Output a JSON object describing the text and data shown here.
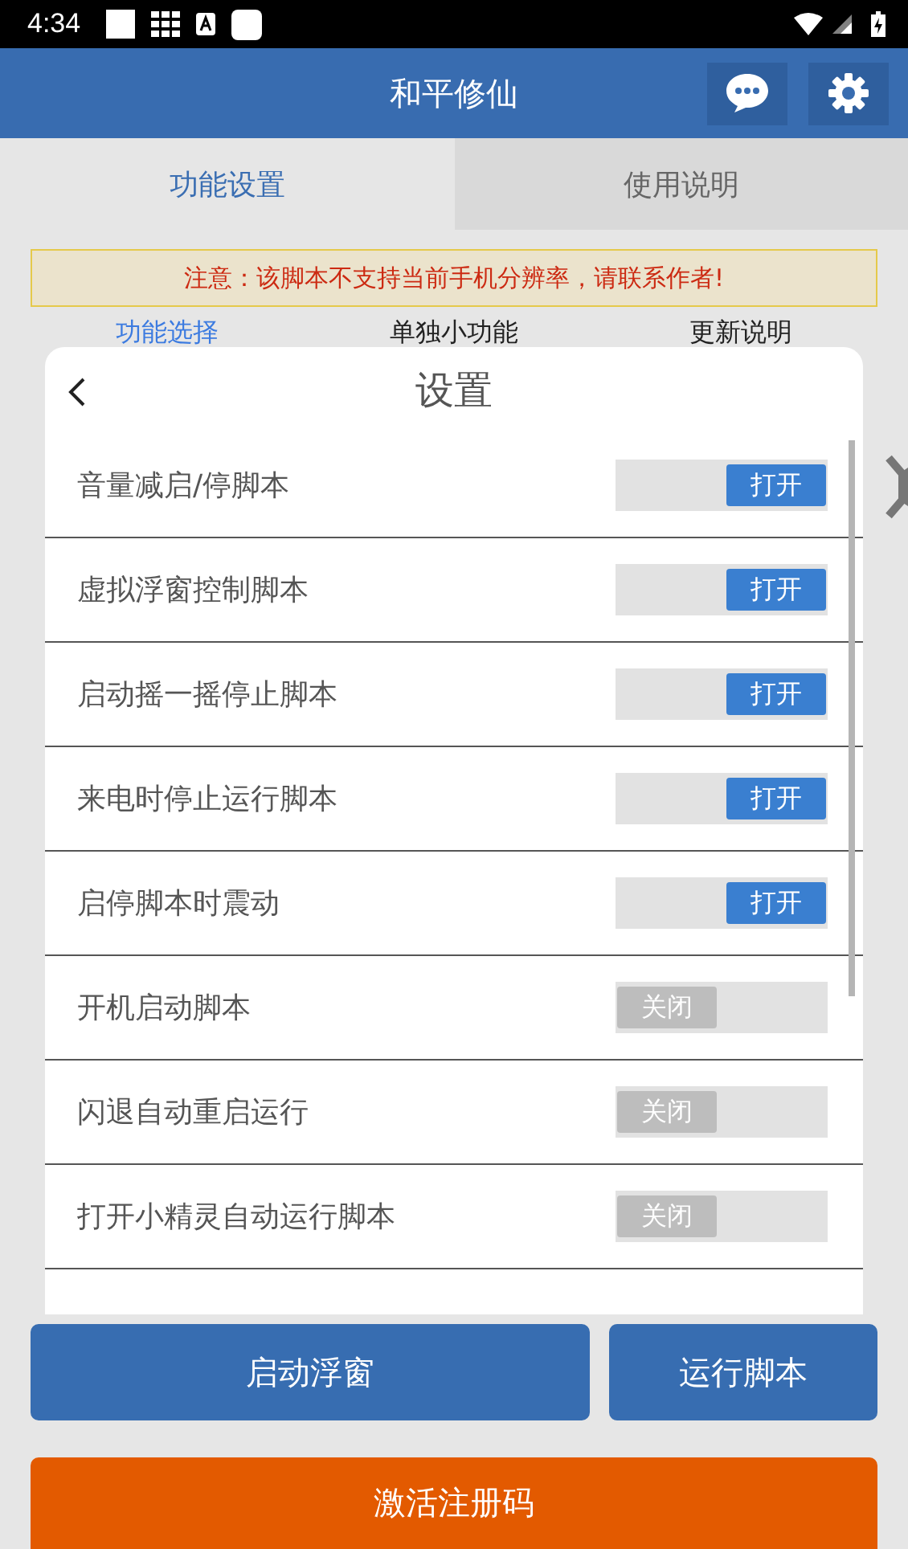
{
  "status_bar": {
    "time": "4:34"
  },
  "app_bar": {
    "title": "和平修仙"
  },
  "tabs": [
    {
      "label": "功能设置",
      "selected": true
    },
    {
      "label": "使用说明",
      "selected": false
    }
  ],
  "notice": "注意：该脚本不支持当前手机分辨率，请联系作者!",
  "sub_tabs": [
    {
      "label": "功能选择",
      "selected": true
    },
    {
      "label": "单独小功能",
      "selected": false
    },
    {
      "label": "更新说明",
      "selected": false
    }
  ],
  "dialog": {
    "title": "设置",
    "items": [
      {
        "label": "音量减启/停脚本",
        "on": true,
        "state_text": "打开"
      },
      {
        "label": "虚拟浮窗控制脚本",
        "on": true,
        "state_text": "打开"
      },
      {
        "label": "启动摇一摇停止脚本",
        "on": true,
        "state_text": "打开"
      },
      {
        "label": "来电时停止运行脚本",
        "on": true,
        "state_text": "打开"
      },
      {
        "label": "启停脚本时震动",
        "on": true,
        "state_text": "打开"
      },
      {
        "label": "开机启动脚本",
        "on": false,
        "state_text": "关闭"
      },
      {
        "label": "闪退自动重启运行",
        "on": false,
        "state_text": "关闭"
      },
      {
        "label": "打开小精灵自动运行脚本",
        "on": false,
        "state_text": "关闭"
      }
    ]
  },
  "buttons": [
    {
      "label": "启动浮窗",
      "kind": "primary"
    },
    {
      "label": "运行脚本",
      "kind": "primary"
    },
    {
      "label": "激活注册码",
      "kind": "accent"
    }
  ]
}
